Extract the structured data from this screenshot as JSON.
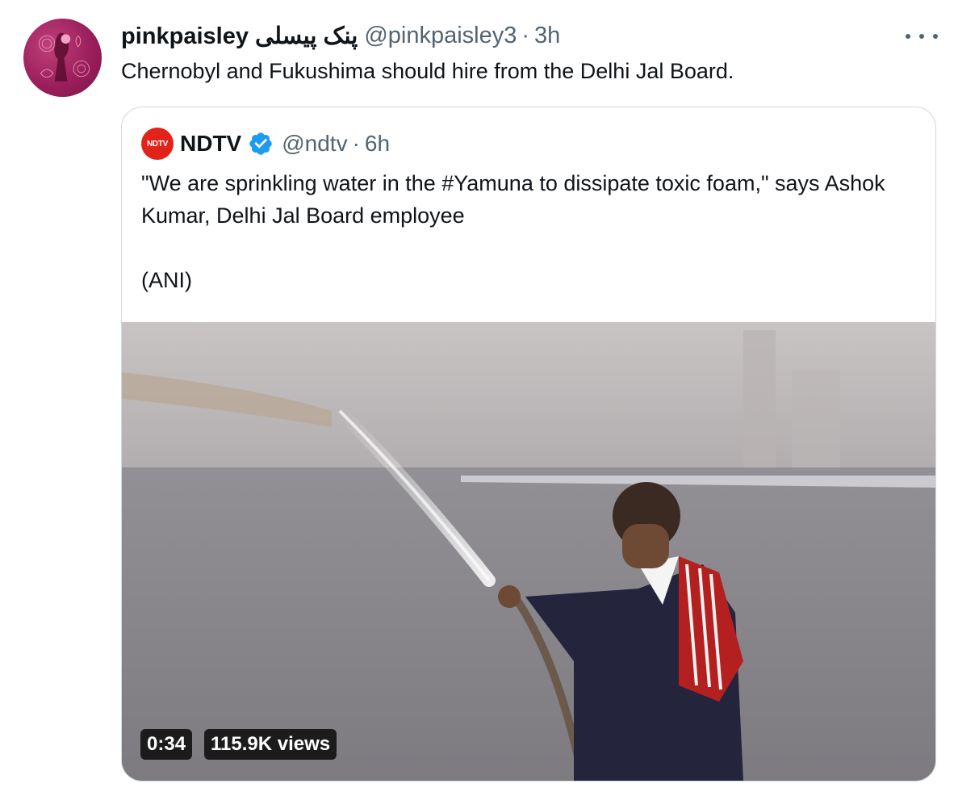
{
  "tweet": {
    "display_name": "pinkpaisley پنک پیسلی",
    "handle": "@pinkpaisley3",
    "separator": "·",
    "time": "3h",
    "text": "Chernobyl and Fukushima should hire from the Delhi Jal Board.",
    "more_icon": "more-horizontal-icon"
  },
  "quoted": {
    "logo_text": "NDTV",
    "display_name": "NDTV",
    "verified_icon": "verified-badge-icon",
    "handle": "@ndtv",
    "separator": "·",
    "time": "6h",
    "text_line1": "\"We are sprinkling water in the #Yamuna to dissipate toxic foam,\" says Ashok Kumar, Delhi Jal Board employee",
    "text_line2": "(ANI)",
    "video": {
      "duration": "0:34",
      "views": "115.9K views"
    }
  },
  "colors": {
    "text": "#0f1419",
    "muted": "#536471",
    "border": "#cfd9de",
    "verified": "#1d9bf0",
    "ndtv_red": "#e2231a"
  }
}
